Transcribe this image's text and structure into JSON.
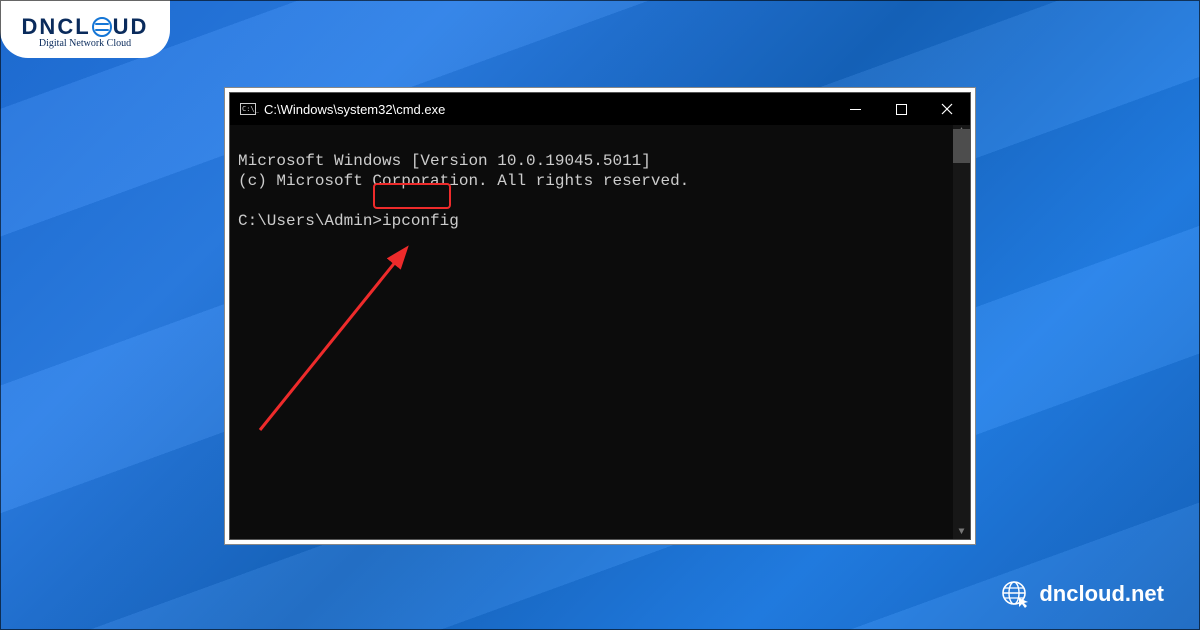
{
  "logo": {
    "brand_prefix": "DNCL",
    "brand_suffix": "UD",
    "tagline": "Digital Network Cloud"
  },
  "window": {
    "title": "C:\\Windows\\system32\\cmd.exe"
  },
  "terminal": {
    "line1": "Microsoft Windows [Version 10.0.19045.5011]",
    "line2": "(c) Microsoft Corporation. All rights reserved.",
    "blank": "",
    "prompt": "C:\\Users\\Admin>",
    "command": "ipconfig"
  },
  "footer": {
    "site": "dncloud.net"
  },
  "colors": {
    "highlight": "#ee2b2b",
    "bg_primary": "#1e6fd9",
    "terminal_bg": "#0c0c0c",
    "terminal_fg": "#cccccc"
  }
}
